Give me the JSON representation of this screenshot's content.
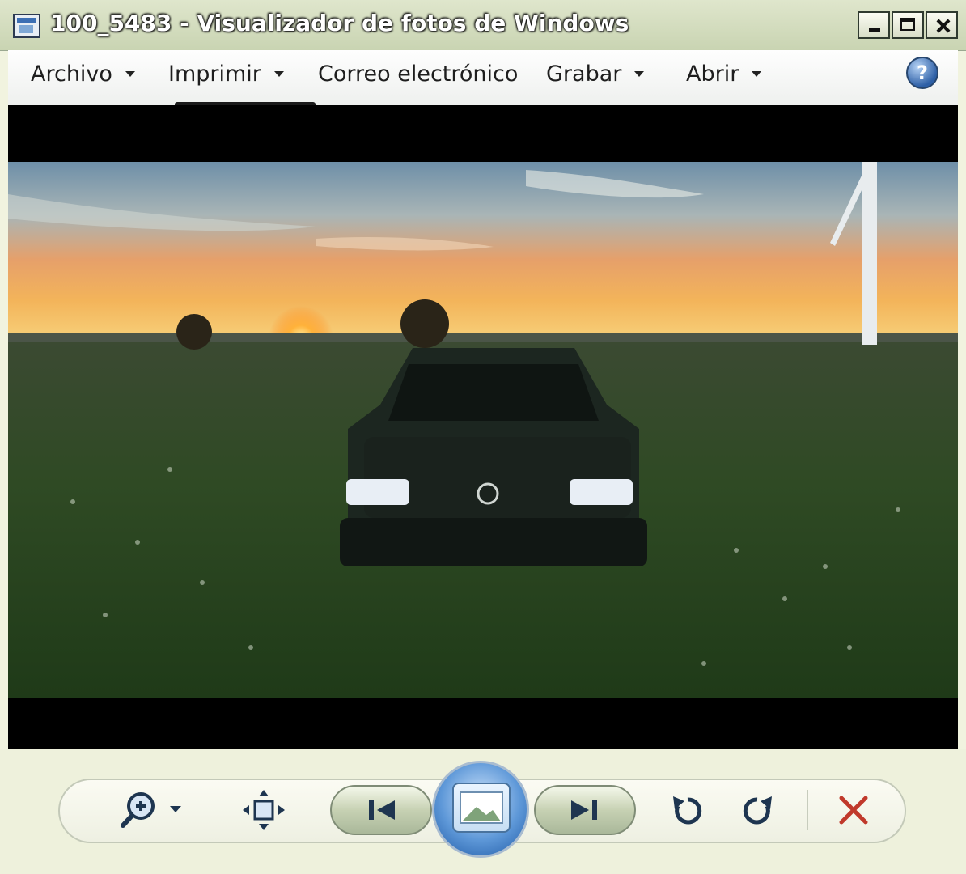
{
  "window": {
    "title": "100_5483 - Visualizador de fotos de Windows",
    "app_icon": "photo-viewer-icon"
  },
  "title_buttons": {
    "minimize": "minimize-icon",
    "maximize": "maximize-icon",
    "close": "close-icon"
  },
  "menu": {
    "items": [
      {
        "label": "Archivo",
        "has_dropdown": true
      },
      {
        "label": "Imprimir",
        "has_dropdown": true
      },
      {
        "label": "Correo electrónico",
        "has_dropdown": false
      },
      {
        "label": "Grabar",
        "has_dropdown": true
      },
      {
        "label": "Abrir",
        "has_dropdown": true
      }
    ],
    "help_icon": "help-icon",
    "help_glyph": "?"
  },
  "photo": {
    "subject": "dark car in a grass field at sunset with a wind turbine"
  },
  "toolbar": {
    "buttons": [
      {
        "icon": "zoom-icon",
        "has_dropdown": true
      },
      {
        "icon": "actual-size-icon"
      },
      {
        "icon": "previous-icon"
      },
      {
        "icon": "slideshow-icon"
      },
      {
        "icon": "next-icon"
      },
      {
        "icon": "rotate-counterclockwise-icon"
      },
      {
        "icon": "rotate-clockwise-icon"
      },
      {
        "icon": "delete-icon"
      }
    ]
  },
  "colors": {
    "title_text": "#ffffff",
    "chrome": "#eef1dc",
    "delete_red": "#c0392b",
    "accent_blue": "#2d5fa6"
  }
}
